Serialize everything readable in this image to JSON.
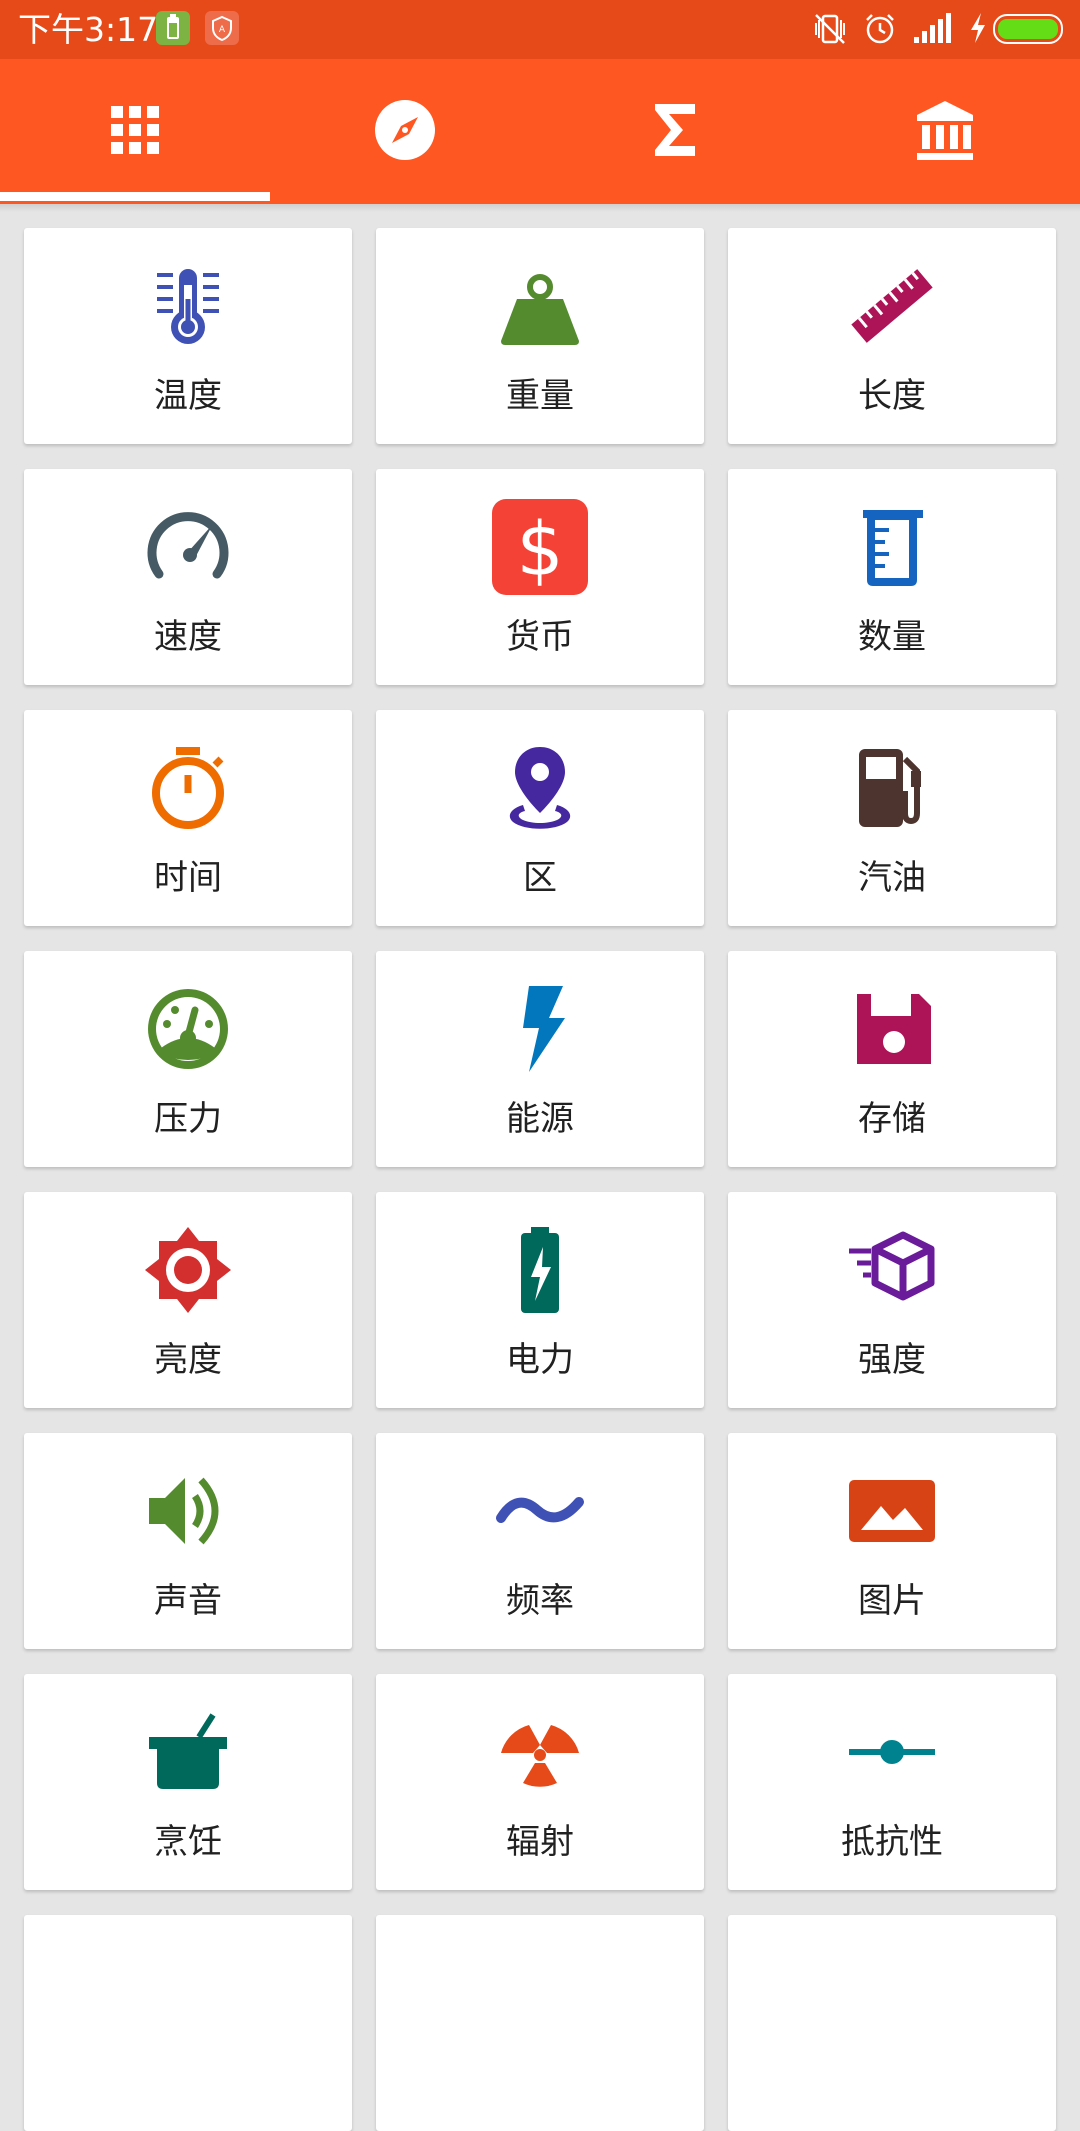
{
  "status_bar": {
    "time": "下午3:17",
    "icons": [
      "battery-saver-icon",
      "shield-icon",
      "vibrate-off-icon",
      "alarm-icon",
      "signal-icon",
      "charging-icon",
      "battery-icon"
    ]
  },
  "tabs": [
    {
      "name": "grid-icon",
      "selected": true
    },
    {
      "name": "compass-icon",
      "selected": false
    },
    {
      "name": "sigma-icon",
      "selected": false
    },
    {
      "name": "bank-icon",
      "selected": false
    }
  ],
  "colors": {
    "status_bar": "#E64A19",
    "tab_bar": "#FF5722",
    "background": "#E5E5E5"
  },
  "categories": [
    {
      "label": "温度",
      "icon": "thermometer-icon",
      "color": "#3F51B5"
    },
    {
      "label": "重量",
      "icon": "weight-icon",
      "color": "#558B2F"
    },
    {
      "label": "长度",
      "icon": "ruler-icon",
      "color": "#AD1457"
    },
    {
      "label": "速度",
      "icon": "speedometer-icon",
      "color": "#455A64"
    },
    {
      "label": "货币",
      "icon": "currency-icon",
      "color": "#F44336"
    },
    {
      "label": "数量",
      "icon": "beaker-icon",
      "color": "#1565C0"
    },
    {
      "label": "时间",
      "icon": "stopwatch-icon",
      "color": "#EF6C00"
    },
    {
      "label": "区",
      "icon": "location-pin-icon",
      "color": "#4527A0"
    },
    {
      "label": "汽油",
      "icon": "gas-station-icon",
      "color": "#4E342E"
    },
    {
      "label": "压力",
      "icon": "gauge-icon",
      "color": "#558B2F"
    },
    {
      "label": "能源",
      "icon": "lightning-icon",
      "color": "#0277BD"
    },
    {
      "label": "存储",
      "icon": "floppy-disk-icon",
      "color": "#AD1457"
    },
    {
      "label": "亮度",
      "icon": "brightness-icon",
      "color": "#D32F2F"
    },
    {
      "label": "电力",
      "icon": "battery-charging-icon",
      "color": "#00695C"
    },
    {
      "label": "强度",
      "icon": "cube-icon",
      "color": "#6A1B9A"
    },
    {
      "label": "声音",
      "icon": "volume-icon",
      "color": "#558B2F"
    },
    {
      "label": "频率",
      "icon": "wave-icon",
      "color": "#3F51B5"
    },
    {
      "label": "图片",
      "icon": "image-icon",
      "color": "#D84315"
    },
    {
      "label": "烹饪",
      "icon": "cooking-pot-icon",
      "color": "#00695C"
    },
    {
      "label": "辐射",
      "icon": "radiation-icon",
      "color": "#E64A19"
    },
    {
      "label": "抵抗性",
      "icon": "resistor-icon",
      "color": "#00838F"
    }
  ]
}
